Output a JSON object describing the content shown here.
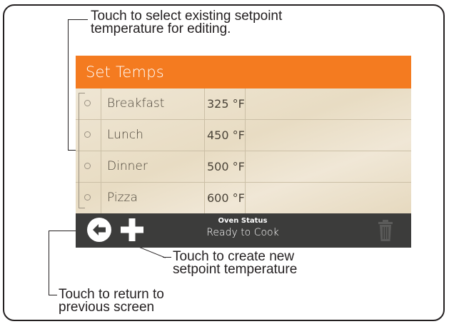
{
  "callouts": {
    "select": [
      "Touch to select existing setpoint",
      "temperature for editing."
    ],
    "create": [
      "Touch to create new",
      "setpoint temperature"
    ],
    "back": [
      "Touch to return to",
      "previous screen"
    ]
  },
  "screen": {
    "title": "Set Temps",
    "rows": [
      {
        "name": "Breakfast",
        "temp": "325 °F"
      },
      {
        "name": "Lunch",
        "temp": "450 °F"
      },
      {
        "name": "Dinner",
        "temp": "500 °F"
      },
      {
        "name": "Pizza",
        "temp": "600 °F"
      }
    ],
    "status": {
      "label": "Oven Status",
      "value": "Ready to Cook"
    },
    "icons": {
      "back": "back-arrow-icon",
      "add": "plus-icon",
      "delete": "trash-icon"
    }
  },
  "colors": {
    "header": "#f47b20",
    "status_bar": "#3c3c3b",
    "table_bg": "#ece2cc"
  }
}
